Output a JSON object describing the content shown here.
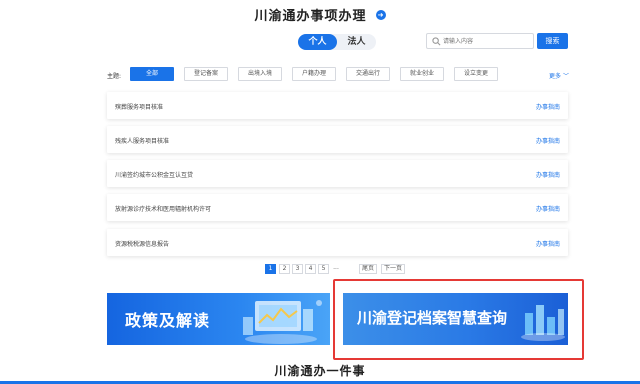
{
  "header": {
    "title": "川渝通办事项办理"
  },
  "toggle": {
    "personal": "个人",
    "legal": "法人"
  },
  "search": {
    "placeholder": "请输入内容",
    "button": "搜索"
  },
  "filters": {
    "label": "主题:",
    "items": [
      "全部",
      "登记备案",
      "出境入境",
      "户籍办理",
      "交通出行",
      "就业创业",
      "设立变更"
    ],
    "active_index": 0,
    "more": "更多"
  },
  "services": [
    {
      "name": "殡葬服务项目核准",
      "action": "办事指南"
    },
    {
      "name": "残疾人服务项目核准",
      "action": "办事指南"
    },
    {
      "name": "川渝签约城市公积金互认互贷",
      "action": "办事指南"
    },
    {
      "name": "放射源诊疗技术和医用辐射机构许可",
      "action": "办事指南"
    },
    {
      "name": "资源税税源信息报告",
      "action": "办事指南"
    }
  ],
  "pagination": {
    "pages": [
      "1",
      "2",
      "3",
      "4",
      "5"
    ],
    "current": "1",
    "ellipsis": "...",
    "prev": "尾页",
    "next": "下一页"
  },
  "banners": {
    "left": "政策及解读",
    "right": "川渝登记档案智慧查询"
  },
  "footer": {
    "title": "川渝通办一件事"
  },
  "colors": {
    "primary": "#1a73e8",
    "highlight": "#e53935"
  }
}
